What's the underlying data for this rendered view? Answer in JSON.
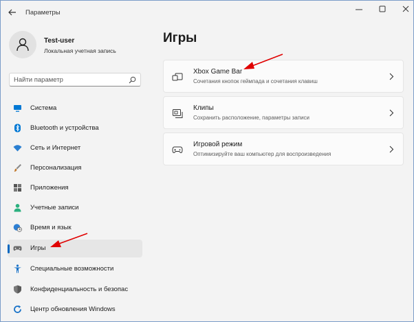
{
  "window": {
    "title": "Параметры",
    "controls": [
      "minimize",
      "maximize",
      "close"
    ]
  },
  "profile": {
    "name": "Test-user",
    "account_type": "Локальная учетная запись"
  },
  "search": {
    "placeholder": "Найти параметр"
  },
  "sidebar": {
    "items": [
      {
        "label": "Система",
        "icon": "monitor-icon",
        "color": "#0078d4",
        "active": false
      },
      {
        "label": "Bluetooth и устройства",
        "icon": "bluetooth-icon",
        "color": "#0078d4",
        "active": false
      },
      {
        "label": "Сеть и Интернет",
        "icon": "wifi-icon",
        "color": "#2a7fd1",
        "active": false
      },
      {
        "label": "Персонализация",
        "icon": "brush-icon",
        "color": "#c0772a",
        "active": false
      },
      {
        "label": "Приложения",
        "icon": "apps-icon",
        "color": "#555555",
        "active": false
      },
      {
        "label": "Учетные записи",
        "icon": "person-icon",
        "color": "#2bb07f",
        "active": false
      },
      {
        "label": "Время и язык",
        "icon": "globe-clock-icon",
        "color": "#2d7fd3",
        "active": false
      },
      {
        "label": "Игры",
        "icon": "gamepad-icon",
        "color": "#6b6b6b",
        "active": true
      },
      {
        "label": "Специальные возможности",
        "icon": "accessibility-icon",
        "color": "#1a73c8",
        "active": false
      },
      {
        "label": "Конфиденциальность и безопас",
        "icon": "shield-icon",
        "color": "#7a7a7a",
        "active": false
      },
      {
        "label": "Центр обновления Windows",
        "icon": "update-icon",
        "color": "#1a73c8",
        "active": false
      }
    ]
  },
  "main": {
    "title": "Игры",
    "cards": [
      {
        "title": "Xbox Game Bar",
        "subtitle": "Сочетания кнопок геймпада и сочетания клавиш",
        "icon": "game-bar-icon"
      },
      {
        "title": "Клипы",
        "subtitle": "Сохранить расположение, параметры записи",
        "icon": "clips-icon"
      },
      {
        "title": "Игровой режим",
        "subtitle": "Оптимизируйте ваш компьютер для воспроизведения",
        "icon": "game-mode-icon"
      }
    ]
  },
  "annotations": {
    "arrow_color": "#e00000"
  },
  "colors": {
    "accent": "#0067c0",
    "window_bg": "#f3f3f3",
    "card_bg": "#fbfbfb"
  }
}
